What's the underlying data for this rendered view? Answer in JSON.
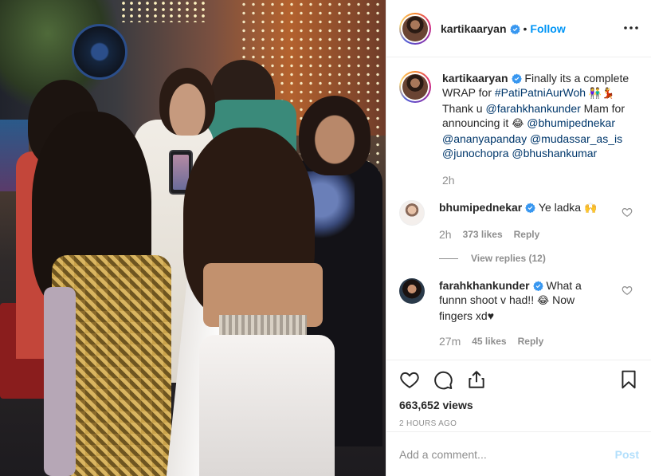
{
  "header": {
    "username": "kartikaaryan",
    "separator": "•",
    "follow_label": "Follow"
  },
  "caption": {
    "username": "kartikaaryan",
    "text_1": "Finally its a complete WRAP for ",
    "hashtag": "#PatiPatniAurWoh",
    "emoji_1": "👫💃",
    "text_2": " Thank u ",
    "mention_farah": "@farahkhankunder",
    "text_3": " Mam for announcing it ",
    "emoji_2": "😂",
    "mention_bhumi": "@bhumipednekar",
    "mention_ananya": "@ananyapanday",
    "mention_mudassar": "@mudassar_as_is",
    "mention_juno": "@junochopra",
    "mention_bhushan": "@bhushankumar",
    "time": "2h"
  },
  "comments": [
    {
      "username": "bhumipednekar",
      "text": "Ye ladka ",
      "emoji": "🙌",
      "time": "2h",
      "likes": "373 likes",
      "reply_label": "Reply",
      "view_replies": "View replies (12)"
    },
    {
      "username": "farahkhankunder",
      "text": "What a funnn shoot v had!! ",
      "emoji": "😂",
      "text_2": " Now fingers xd",
      "emoji_2": "♥",
      "time": "27m",
      "likes": "45 likes",
      "reply_label": "Reply"
    }
  ],
  "stats": {
    "views": "663,652 views",
    "ago": "2 HOURS AGO"
  },
  "add_comment": {
    "placeholder": "Add a comment...",
    "post_label": "Post"
  },
  "colors": {
    "link_blue": "#0095f6",
    "mention": "#00376b",
    "muted": "#8e8e8e",
    "verified": "#3897f0"
  },
  "icons": [
    "more-horizontal-icon",
    "verified-badge-icon",
    "heart-icon",
    "comment-icon",
    "share-icon",
    "bookmark-icon"
  ]
}
